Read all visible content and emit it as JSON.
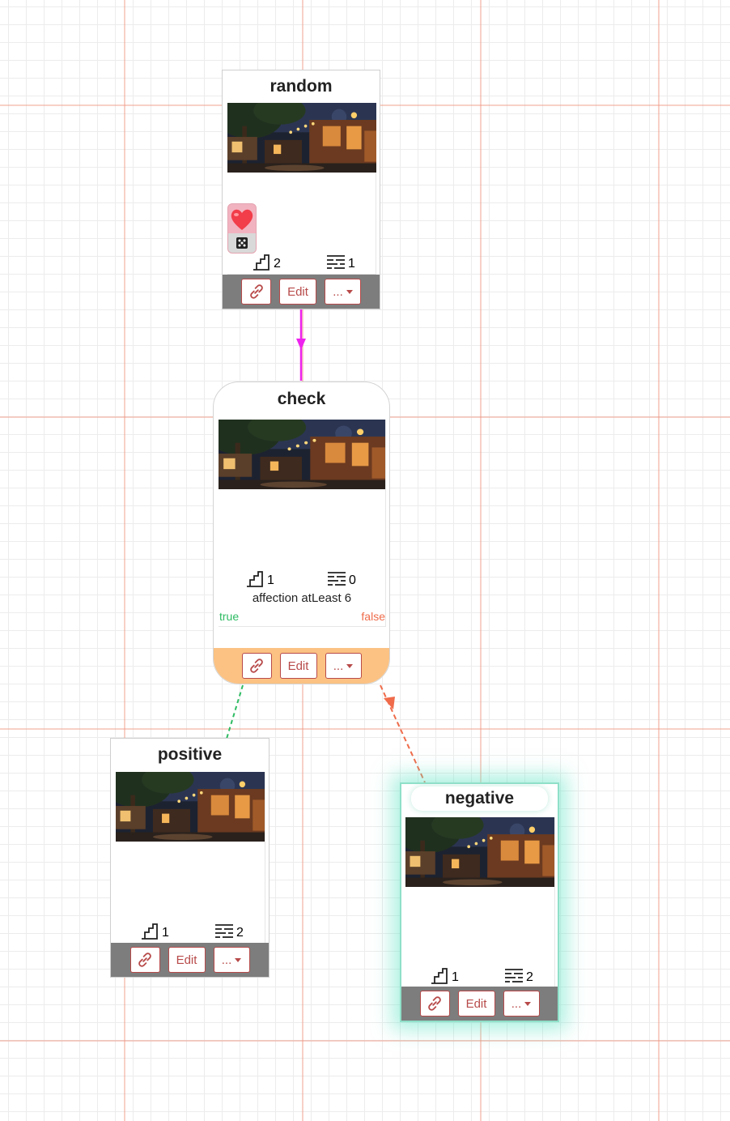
{
  "colors": {
    "edge_main": "#ee22ee",
    "edge_true": "#2dbb62",
    "edge_false": "#ef6b4a",
    "footer_gray": "#7d7d7d",
    "footer_check": "#fbc283",
    "button_accent": "#b84a4a",
    "highlight_glow": "#6ee6c8"
  },
  "nodes": {
    "random": {
      "title": "random",
      "steps_count": "2",
      "lines_count": "1",
      "badge_icons": [
        "heart-icon",
        "dice-icon"
      ],
      "buttons": {
        "link_icon": "link-icon",
        "edit": "Edit",
        "more": "..."
      }
    },
    "check": {
      "title": "check",
      "steps_count": "1",
      "lines_count": "0",
      "condition": "affection atLeast 6",
      "true_label": "true",
      "false_label": "false",
      "buttons": {
        "link_icon": "link-icon",
        "edit": "Edit",
        "more": "..."
      }
    },
    "positive": {
      "title": "positive",
      "steps_count": "1",
      "lines_count": "2",
      "buttons": {
        "link_icon": "link-icon",
        "edit": "Edit",
        "more": "..."
      }
    },
    "negative": {
      "title": "negative",
      "steps_count": "1",
      "lines_count": "2",
      "buttons": {
        "link_icon": "link-icon",
        "edit": "Edit",
        "more": "..."
      }
    }
  }
}
